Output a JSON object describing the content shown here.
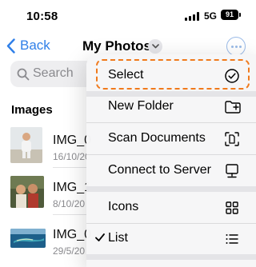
{
  "status_bar": {
    "time": "10:58",
    "network": "5G",
    "battery": "91"
  },
  "nav": {
    "back_label": "Back",
    "title": "My Photos"
  },
  "search": {
    "placeholder": "Search"
  },
  "section": {
    "title": "Images"
  },
  "files": [
    {
      "name": "IMG_0",
      "date": "16/10/20"
    },
    {
      "name": "IMG_1",
      "date": "8/10/20"
    },
    {
      "name": "IMG_0",
      "date": "29/5/20"
    }
  ],
  "menu": {
    "items": [
      {
        "label": "Select",
        "icon": "checkmark-circle-icon"
      },
      {
        "label": "New Folder",
        "icon": "folder-plus-icon"
      },
      {
        "label": "Scan Documents",
        "icon": "document-scan-icon"
      },
      {
        "label": "Connect to Server",
        "icon": "server-monitor-icon"
      },
      {
        "label": "Icons",
        "icon": "grid-icon"
      },
      {
        "label": "List",
        "icon": "list-icon",
        "checked": true
      }
    ]
  },
  "colors": {
    "accent": "#2f7fe8",
    "highlight": "#f07a1c"
  }
}
